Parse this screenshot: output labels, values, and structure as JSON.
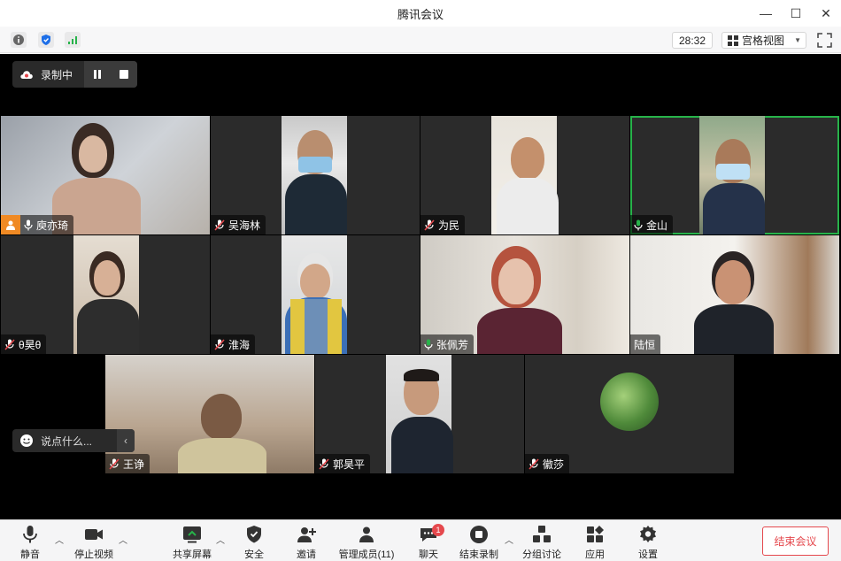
{
  "window": {
    "title": "腾讯会议"
  },
  "toolbar": {
    "timer": "28:32",
    "view_label": "宫格视图"
  },
  "recording": {
    "label": "录制中"
  },
  "participants": [
    {
      "name": "庾亦琦",
      "host": true
    },
    {
      "name": "吴海林"
    },
    {
      "name": "为民"
    },
    {
      "name": "金山",
      "speaking": true
    },
    {
      "name": "θ昊θ"
    },
    {
      "name": "淮海"
    },
    {
      "name": "张佩芳"
    },
    {
      "name": "陆恒"
    },
    {
      "name": "王诤"
    },
    {
      "name": "郭昊平"
    },
    {
      "name": "徽莎"
    }
  ],
  "chat": {
    "placeholder": "说点什么..."
  },
  "bottom": {
    "mute": "静音",
    "stop_video": "停止视频",
    "share": "共享屏幕",
    "security": "安全",
    "invite": "邀请",
    "members": "管理成员(11)",
    "chat": "聊天",
    "chat_badge": "1",
    "end_record": "结束录制",
    "breakout": "分组讨论",
    "apps": "应用",
    "settings": "设置",
    "end_meeting": "结束会议"
  },
  "colors": {
    "accent_green": "#27b34a",
    "end_red": "#e5484d",
    "host_orange": "#f08a24"
  }
}
